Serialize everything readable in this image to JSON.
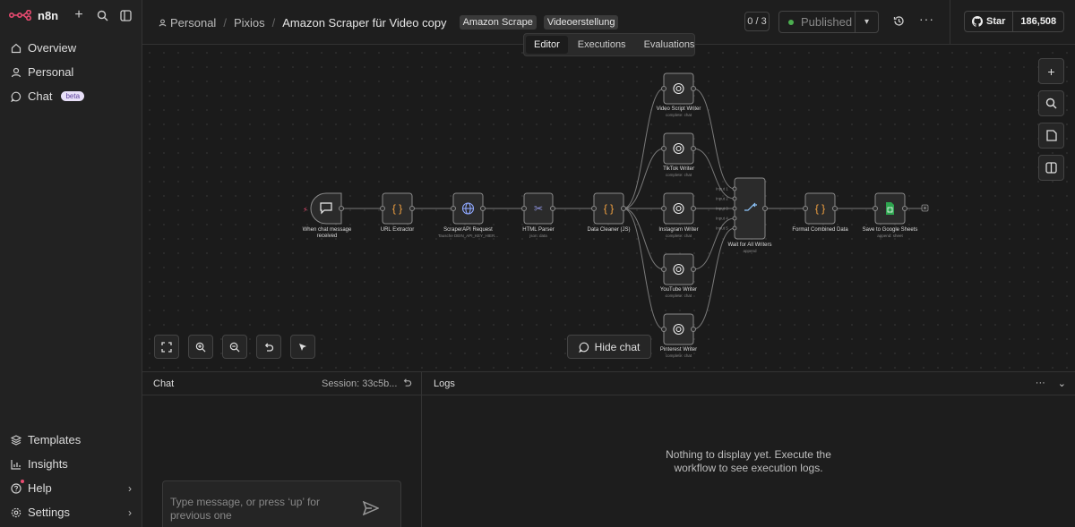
{
  "app": {
    "name": "n8n"
  },
  "sidebar": {
    "items": [
      {
        "label": "Overview",
        "icon": "home-icon"
      },
      {
        "label": "Personal",
        "icon": "user-icon"
      },
      {
        "label": "Chat",
        "icon": "chat-icon",
        "badge": "beta"
      }
    ],
    "bottom_items": [
      {
        "label": "Templates",
        "icon": "templates-icon"
      },
      {
        "label": "Insights",
        "icon": "insights-icon"
      },
      {
        "label": "Help",
        "icon": "help-icon"
      },
      {
        "label": "Settings",
        "icon": "settings-icon"
      }
    ]
  },
  "header": {
    "breadcrumb": [
      "Personal",
      "Pixios"
    ],
    "workflow_title": "Amazon Scraper für Video copy",
    "tags": [
      "Amazon Scrape",
      "Videoerstellung"
    ],
    "counter": "0 / 3",
    "published_label": "Published",
    "github_star": "Star",
    "github_count": "186,508"
  },
  "tabs": [
    "Editor",
    "Executions",
    "Evaluations"
  ],
  "nodes": {
    "trigger": {
      "label1": "When chat message",
      "label2": "received"
    },
    "url": {
      "label": "URL Extractor"
    },
    "scraper": {
      "label": "ScraperAPI Request",
      "sub": "Tausche DEIN_API_KEY_HIER..."
    },
    "html": {
      "label": "HTML Parser",
      "sub": "json: data"
    },
    "cleaner": {
      "label": "Data Cleaner (JS)"
    },
    "video": {
      "label": "Video Script Writer",
      "sub": "complete: chat"
    },
    "tiktok": {
      "label": "TikTok Writer",
      "sub": "complete: chat"
    },
    "instagram": {
      "label": "Instagram Writer",
      "sub": "complete: chat"
    },
    "youtube": {
      "label": "YouTube Writer",
      "sub": "complete: chat"
    },
    "pinterest": {
      "label": "Pinterest Writer",
      "sub": "complete: chat"
    },
    "wait": {
      "label": "Wait for All Writers",
      "sub": "append",
      "inputs": [
        "Input 1",
        "Input 2",
        "Input 3",
        "Input 4",
        "Input 5"
      ]
    },
    "format": {
      "label": "Format Combined Data"
    },
    "sheets": {
      "label": "Save to Google Sheets",
      "sub": "append: sheet"
    }
  },
  "canvas": {
    "hide_chat_label": "Hide chat"
  },
  "chat_panel": {
    "title": "Chat",
    "session": "Session: 33c5b...",
    "input_placeholder_line1": "Type message, or press ‘up’ for",
    "input_placeholder_line2": "previous one"
  },
  "logs_panel": {
    "title": "Logs",
    "empty_line1": "Nothing to display yet. Execute the",
    "empty_line2": "workflow to see execution logs."
  }
}
